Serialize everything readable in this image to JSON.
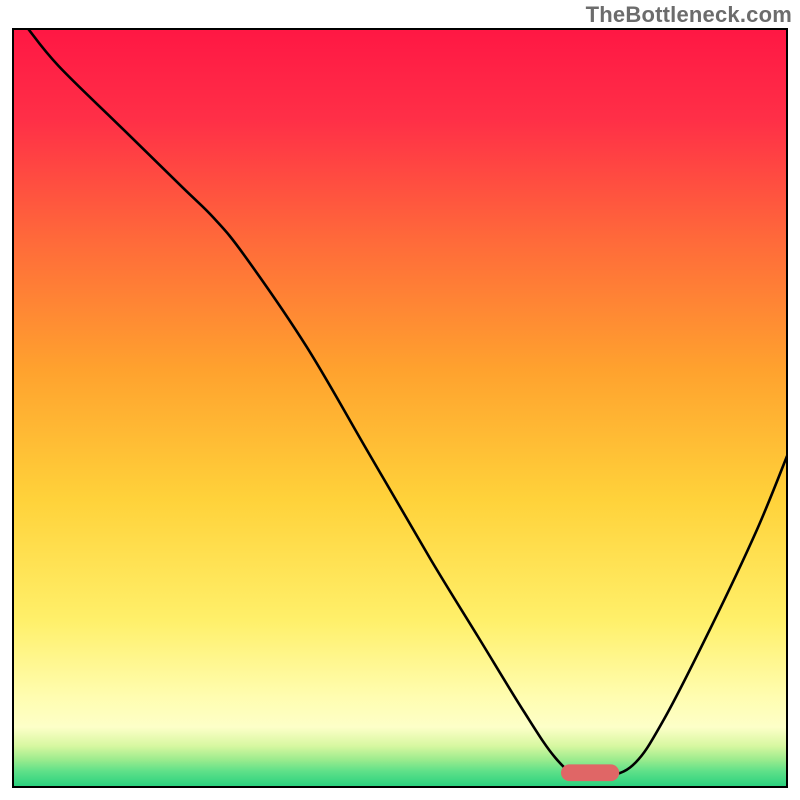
{
  "watermark": "TheBottleneck.com",
  "chart_data": {
    "type": "line",
    "title": "",
    "xlabel": "",
    "ylabel": "",
    "xlim": [
      0,
      100
    ],
    "ylim": [
      0,
      100
    ],
    "background": {
      "type": "vertical-gradient",
      "note": "smooth gradient from red (top) through orange/yellow to pale-yellow, then a thin green band at the very bottom",
      "stops": [
        {
          "pos": 0.0,
          "color": "#ff1744"
        },
        {
          "pos": 0.12,
          "color": "#ff2f47"
        },
        {
          "pos": 0.28,
          "color": "#ff6a3a"
        },
        {
          "pos": 0.45,
          "color": "#ffa22e"
        },
        {
          "pos": 0.62,
          "color": "#ffd23a"
        },
        {
          "pos": 0.78,
          "color": "#fff06a"
        },
        {
          "pos": 0.88,
          "color": "#fffdb0"
        },
        {
          "pos": 0.92,
          "color": "#fdffc8"
        },
        {
          "pos": 0.945,
          "color": "#d6f7a0"
        },
        {
          "pos": 0.962,
          "color": "#9eec8e"
        },
        {
          "pos": 0.978,
          "color": "#5fe089"
        },
        {
          "pos": 1.0,
          "color": "#24d07d"
        }
      ]
    },
    "series": [
      {
        "name": "bottleneck-curve",
        "color": "#000000",
        "stroke_width": 2.6,
        "x": [
          2,
          6,
          14,
          22,
          26,
          30,
          38,
          46,
          54,
          60,
          66,
          70,
          73,
          76,
          80,
          84,
          90,
          96,
          100
        ],
        "y": [
          100,
          95,
          87,
          79,
          75,
          70,
          58,
          44,
          30,
          20,
          10,
          4,
          1.5,
          1.5,
          3,
          9,
          21,
          34,
          44
        ]
      }
    ],
    "marker": {
      "name": "optimal-range-marker",
      "color": "#e06666",
      "x_center": 74.5,
      "y": 2.0,
      "width": 7.5,
      "height": 2.2,
      "rx": 1.1
    }
  }
}
